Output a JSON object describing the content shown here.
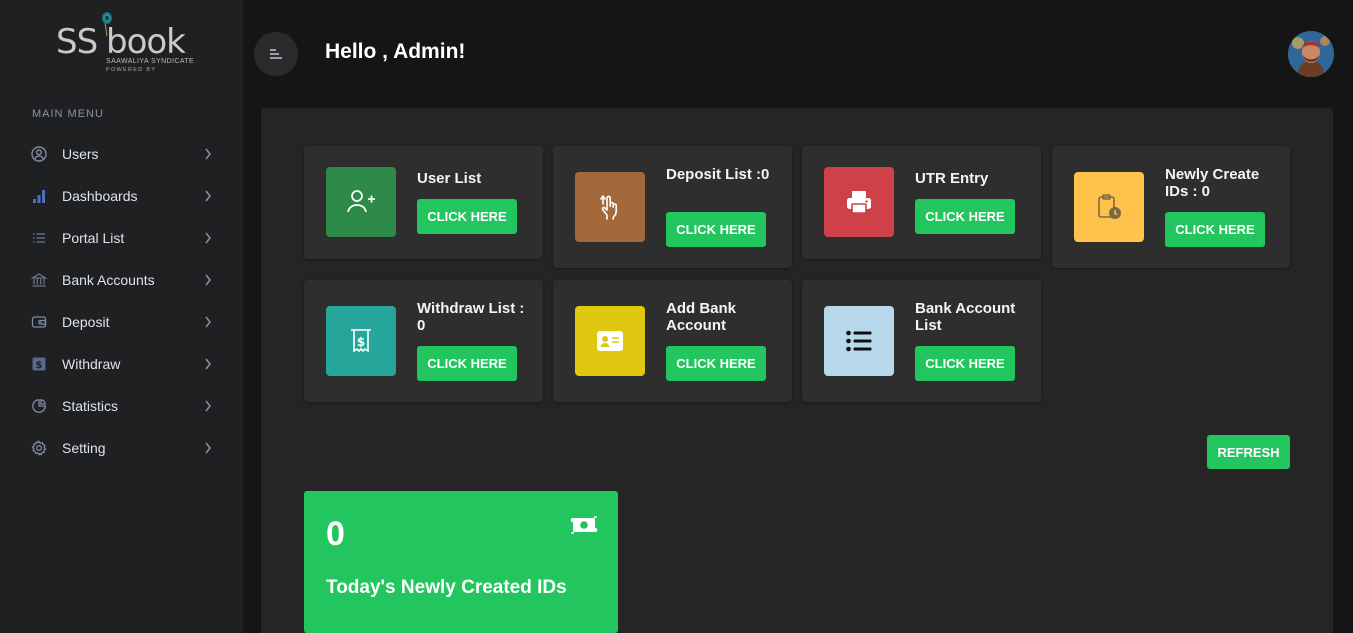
{
  "logo": {
    "brand_left": "SS",
    "brand_right": "book",
    "tagline": "SAAWALIYA SYNDICATE",
    "powered": "POWERED BY"
  },
  "sidebar": {
    "section_title": "MAIN MENU",
    "items": [
      {
        "label": "Users",
        "icon": "user-circle-icon"
      },
      {
        "label": "Dashboards",
        "icon": "bar-chart-icon"
      },
      {
        "label": "Portal List",
        "icon": "list-icon"
      },
      {
        "label": "Bank Accounts",
        "icon": "bank-icon"
      },
      {
        "label": "Deposit",
        "icon": "wallet-icon"
      },
      {
        "label": "Withdraw",
        "icon": "dollar-square-icon"
      },
      {
        "label": "Statistics",
        "icon": "pie-chart-icon"
      },
      {
        "label": "Setting",
        "icon": "gear-icon"
      }
    ]
  },
  "header": {
    "greeting": "Hello , Admin!"
  },
  "cards": [
    {
      "title": "User List",
      "button": "CLICK HERE",
      "icon": "user-plus-icon",
      "color": "#2e8a48"
    },
    {
      "title": "Deposit List :0",
      "button": "CLICK HERE",
      "icon": "hand-tap-icon",
      "color": "#a4693a"
    },
    {
      "title": "UTR Entry",
      "button": "CLICK HERE",
      "icon": "printer-icon",
      "color": "#cf4148"
    },
    {
      "title": "Newly Create IDs : 0",
      "button": "CLICK HERE",
      "icon": "clipboard-clock-icon",
      "color": "#ffc24b"
    },
    {
      "title": "Withdraw List : 0",
      "button": "CLICK HERE",
      "icon": "receipt-dollar-icon",
      "color": "#26a69a"
    },
    {
      "title": "Add Bank Account",
      "button": "CLICK HERE",
      "icon": "id-card-icon",
      "color": "#e0c811"
    },
    {
      "title": "Bank Account List",
      "button": "CLICK HERE",
      "icon": "bullet-list-icon",
      "color": "#b7d7ea"
    }
  ],
  "refresh_label": "REFRESH",
  "stat": {
    "value": "0",
    "label": "Today's Newly Created IDs",
    "icon": "money-exchange-icon",
    "color": "#22c55e"
  }
}
